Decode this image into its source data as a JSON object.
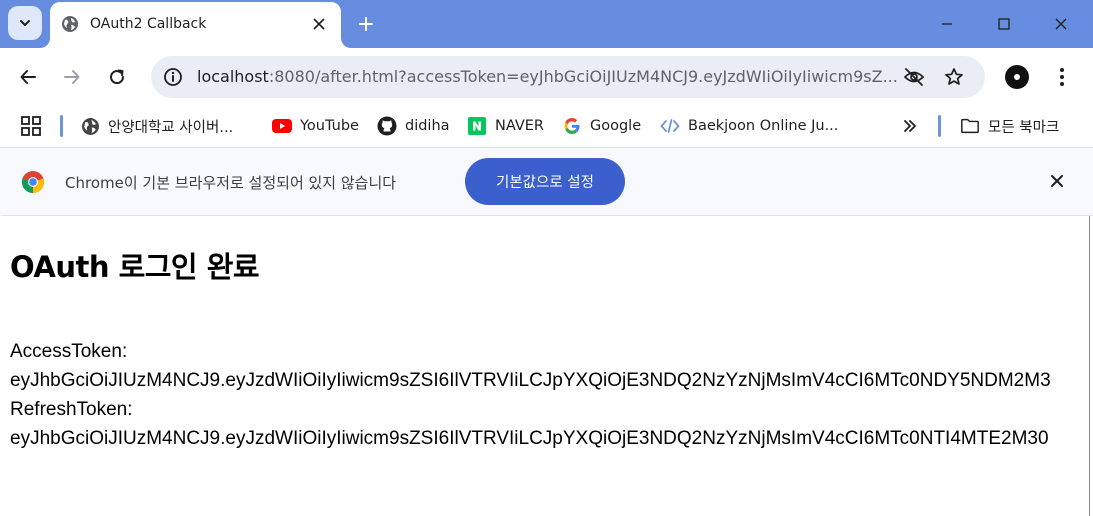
{
  "browser": {
    "tab": {
      "title": "OAuth2 Callback"
    },
    "address_bar": {
      "url_host": "localhost",
      "url_rest": ":8080/after.html?accessToken=eyJhbGciOiJIUzM4NCJ9.eyJzdWIiOiIyIiwicm9sZ..."
    },
    "bookmarks": [
      {
        "label": "안양대학교 사이버...",
        "icon": "globe-icon"
      },
      {
        "label": "YouTube",
        "icon": "youtube-icon"
      },
      {
        "label": "didiha",
        "icon": "github-icon"
      },
      {
        "label": "NAVER",
        "icon": "naver-icon"
      },
      {
        "label": "Google",
        "icon": "google-icon"
      },
      {
        "label": "Baekjoon Online Ju...",
        "icon": "code-icon"
      }
    ],
    "all_bookmarks_label": "모든 북마크",
    "infobar": {
      "message": "Chrome이 기본 브라우저로 설정되어 있지 않습니다",
      "button_label": "기본값으로 설정"
    }
  },
  "page": {
    "title": "OAuth 로그인 완료",
    "access_token_label": "AccessToken:",
    "access_token_value": "eyJhbGciOiJIUzM4NCJ9.eyJzdWIiOiIyIiwicm9sZSI6IlVTRVIiLCJpYXQiOjE3NDQ2NzYzNjMsImV4cCI6MTc0NDY5NDM2M3",
    "refresh_token_label": "RefreshToken:",
    "refresh_token_value": "eyJhbGciOiJIUzM4NCJ9.eyJzdWIiOiIyIiwicm9sZSI6IlVTRVIiLCJpYXQiOjE3NDQ2NzYzNjMsImV4cCI6MTc0NTI4MTE2M30"
  },
  "colors": {
    "titlebar": "#668de0",
    "infobar_button": "#3b5fcc"
  }
}
